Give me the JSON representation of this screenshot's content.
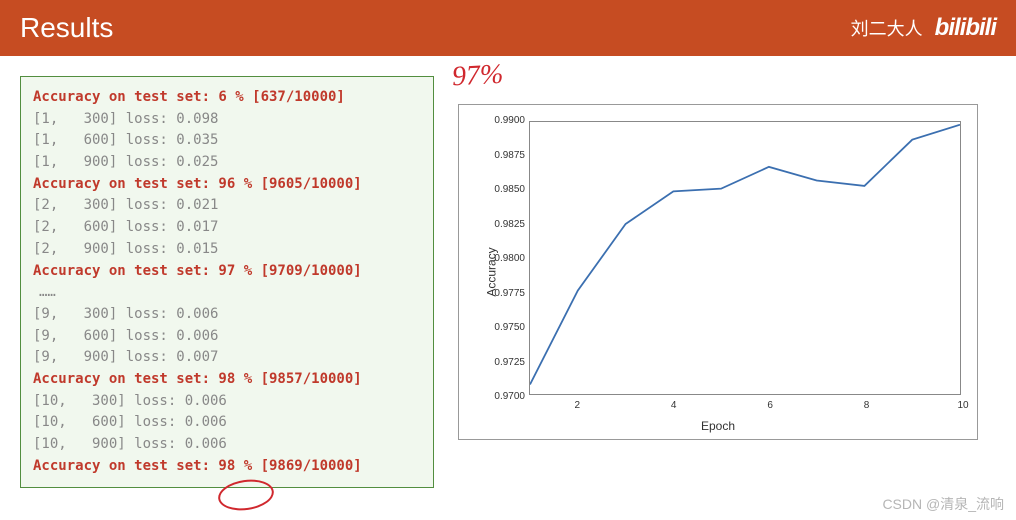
{
  "header": {
    "title": "Results",
    "author": "刘二大人",
    "logo": "bilibili"
  },
  "log": {
    "lines": [
      {
        "type": "acc",
        "text": "Accuracy on test set: 6 % [637/10000]"
      },
      {
        "type": "loss",
        "text": "[1,   300] loss: 0.098"
      },
      {
        "type": "loss",
        "text": "[1,   600] loss: 0.035"
      },
      {
        "type": "loss",
        "text": "[1,   900] loss: 0.025"
      },
      {
        "type": "acc",
        "text": "Accuracy on test set: 96 % [9605/10000]"
      },
      {
        "type": "loss",
        "text": "[2,   300] loss: 0.021"
      },
      {
        "type": "loss",
        "text": "[2,   600] loss: 0.017"
      },
      {
        "type": "loss",
        "text": "[2,   900] loss: 0.015"
      },
      {
        "type": "acc",
        "text": "Accuracy on test set: 97 % [9709/10000]"
      },
      {
        "type": "ellipsis",
        "text": "……"
      },
      {
        "type": "loss",
        "text": "[9,   300] loss: 0.006"
      },
      {
        "type": "loss",
        "text": "[9,   600] loss: 0.006"
      },
      {
        "type": "loss",
        "text": "[9,   900] loss: 0.007"
      },
      {
        "type": "acc",
        "text": "Accuracy on test set: 98 % [9857/10000]"
      },
      {
        "type": "loss",
        "text": "[10,   300] loss: 0.006"
      },
      {
        "type": "loss",
        "text": "[10,   600] loss: 0.006"
      },
      {
        "type": "loss",
        "text": "[10,   900] loss: 0.006"
      },
      {
        "type": "acc",
        "text": "Accuracy on test set: 98 % [9869/10000]"
      }
    ]
  },
  "annotation": "97%",
  "watermark": "CSDN @清泉_流响",
  "chart_data": {
    "type": "line",
    "title": "",
    "xlabel": "Epoch",
    "ylabel": "Accuracy",
    "x": [
      1,
      2,
      3,
      4,
      5,
      6,
      7,
      8,
      9,
      10
    ],
    "y": [
      0.9707,
      0.9776,
      0.9825,
      0.9849,
      0.9851,
      0.9867,
      0.9857,
      0.9853,
      0.9887,
      0.9898
    ],
    "xticks": [
      2,
      4,
      6,
      8,
      10
    ],
    "yticks": [
      0.97,
      0.9725,
      0.975,
      0.9775,
      0.98,
      0.9825,
      0.985,
      0.9875,
      0.99
    ],
    "xlim": [
      1,
      10
    ],
    "ylim": [
      0.97,
      0.99
    ]
  }
}
